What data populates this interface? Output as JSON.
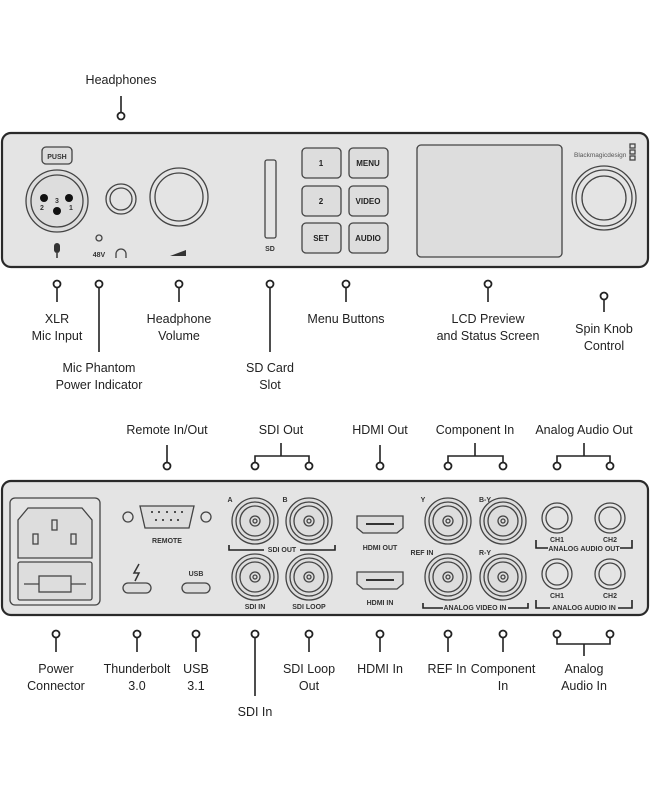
{
  "front": {
    "callouts": {
      "headphones": "Headphones",
      "xlr": [
        "XLR",
        "Mic Input"
      ],
      "phantom": [
        "Mic Phantom",
        "Power Indicator"
      ],
      "volume": [
        "Headphone",
        "Volume"
      ],
      "sd": [
        "SD Card",
        "Slot"
      ],
      "menu": "Menu Buttons",
      "lcd": [
        "LCD Preview",
        "and Status Screen"
      ],
      "knob": [
        "Spin Knob",
        "Control"
      ]
    },
    "panel": {
      "push": "PUSH",
      "pins": [
        "2",
        "3",
        "1"
      ],
      "phantom_label": "48V",
      "sd_label": "SD",
      "buttons": [
        "1",
        "MENU",
        "2",
        "VIDEO",
        "SET",
        "AUDIO"
      ],
      "logo": "Blackmagicdesign"
    }
  },
  "back": {
    "callouts_top": {
      "remote": "Remote In/Out",
      "sdi_out": "SDI Out",
      "hdmi_out": "HDMI Out",
      "component_in": "Component In",
      "analog_out": "Analog Audio Out"
    },
    "callouts_bottom": {
      "power": [
        "Power",
        "Connector"
      ],
      "thunderbolt": [
        "Thunderbolt",
        "3.0"
      ],
      "usb": [
        "USB",
        "3.1"
      ],
      "sdi_in": "SDI In",
      "sdi_loop": [
        "SDI Loop",
        "Out"
      ],
      "hdmi_in": "HDMI In",
      "ref_in": "REF In",
      "component": [
        "Component",
        "In"
      ],
      "analog_in": [
        "Analog",
        "Audio In"
      ]
    },
    "panel": {
      "remote": "REMOTE",
      "usb": "USB",
      "a": "A",
      "b": "B",
      "sdi_out": "SDI OUT",
      "sdi_in": "SDI IN",
      "sdi_loop": "SDI LOOP",
      "hdmi_out": "HDMI OUT",
      "hdmi_in": "HDMI IN",
      "y": "Y",
      "by": "B-Y",
      "ref_in": "REF IN",
      "ry": "R-Y",
      "analog_video_in": "ANALOG VIDEO IN",
      "ch1": "CH1",
      "ch2": "CH2",
      "analog_audio_out": "ANALOG AUDIO OUT",
      "analog_audio_in": "ANALOG AUDIO IN"
    }
  }
}
